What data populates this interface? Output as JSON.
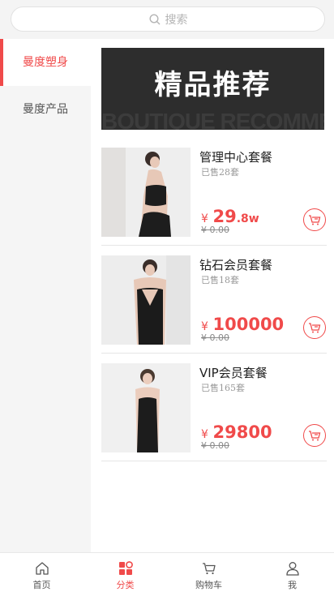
{
  "search": {
    "placeholder": "搜索"
  },
  "sidebar": {
    "items": [
      {
        "label": "曼度塑身"
      },
      {
        "label": "曼度产品"
      }
    ]
  },
  "banner": {
    "title": "精品推荐",
    "subtitle": "BOUTIQUE RECOMMENDATION"
  },
  "products": [
    {
      "title": "管理中心套餐",
      "sold": "已售28套",
      "currency": "¥",
      "price": "29",
      "price_suffix": ".8w",
      "old_price": "¥ 0.00"
    },
    {
      "title": "钻石会员套餐",
      "sold": "已售18套",
      "currency": "¥",
      "price": "100000",
      "price_suffix": "",
      "old_price": "¥ 0.00"
    },
    {
      "title": "VIP会员套餐",
      "sold": "已售165套",
      "currency": "¥",
      "price": "29800",
      "price_suffix": "",
      "old_price": "¥ 0.00"
    }
  ],
  "tabbar": {
    "items": [
      {
        "label": "首页",
        "icon": "home-icon"
      },
      {
        "label": "分类",
        "icon": "category-icon"
      },
      {
        "label": "购物车",
        "icon": "cart-icon"
      },
      {
        "label": "我",
        "icon": "user-icon"
      }
    ]
  },
  "colors": {
    "accent": "#f04a4a",
    "sidebar_bg": "#f5f5f5",
    "banner_bg": "#2d2d2d"
  }
}
